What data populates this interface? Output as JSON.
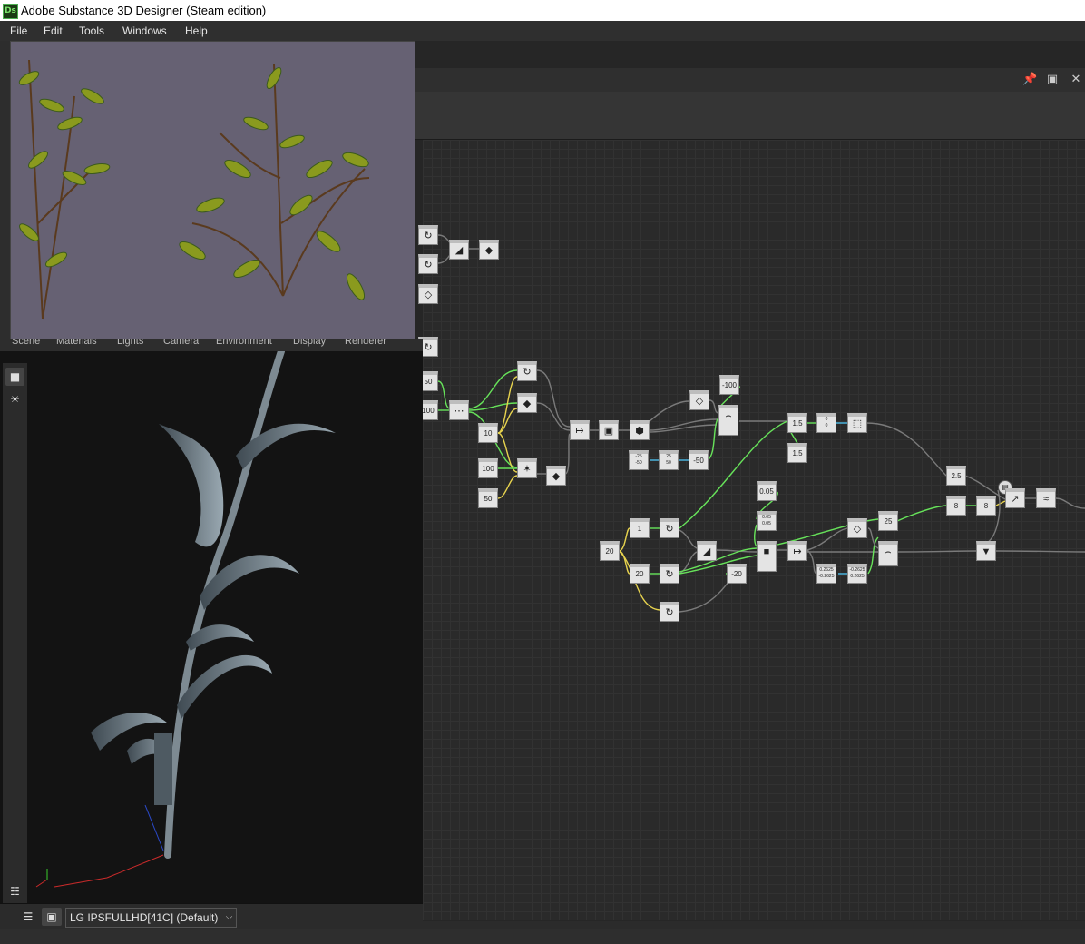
{
  "window": {
    "title": "Adobe Substance 3D Designer (Steam edition)",
    "logo_text": "Ds"
  },
  "menu": {
    "items": [
      {
        "label": "File",
        "id": "file"
      },
      {
        "label": "Edit",
        "id": "edit"
      },
      {
        "label": "Tools",
        "id": "tools"
      },
      {
        "label": "Windows",
        "id": "windows"
      },
      {
        "label": "Help",
        "id": "help"
      }
    ]
  },
  "graph_tab_icons": [
    "pin-icon",
    "restore-icon",
    "close-icon"
  ],
  "panel3d": {
    "tabs": [
      "Scene",
      "Materials",
      "Lights",
      "Camera",
      "Environment",
      "Display",
      "Renderer"
    ],
    "display_device": "LG IPSFULLHD[41C] (Default)"
  },
  "nodes": {
    "n_50": "50",
    "n_100a": "100",
    "n_10": "10",
    "n_100b": "100",
    "n_50b": "50",
    "n_m100": "-100",
    "n_m50": "-50",
    "n_15a": "1.5",
    "n_15b": "1.5",
    "n_005": "0.05",
    "n_005b_1": "0.05",
    "n_005b_2": "0.05",
    "n_25": "25",
    "n_25b": "2.5",
    "n_8a": "8",
    "n_8b": "8",
    "n_1": "1",
    "n_20a": "20",
    "n_20b": "20",
    "n_m20": "-20",
    "n_m25_1": "-25",
    "n_m25_2": "-50",
    "n_25c_1": "25",
    "n_25c_2": "50",
    "n_0262_1": "0.2625",
    "n_0262_2": "0",
    "n_0262_3": "-0.2625",
    "n_m0262_1": "-0.2625",
    "n_m0262_2": "20",
    "n_m0262_3": "0.2625",
    "n_15c_1": "0",
    "n_15c_2": "0"
  }
}
